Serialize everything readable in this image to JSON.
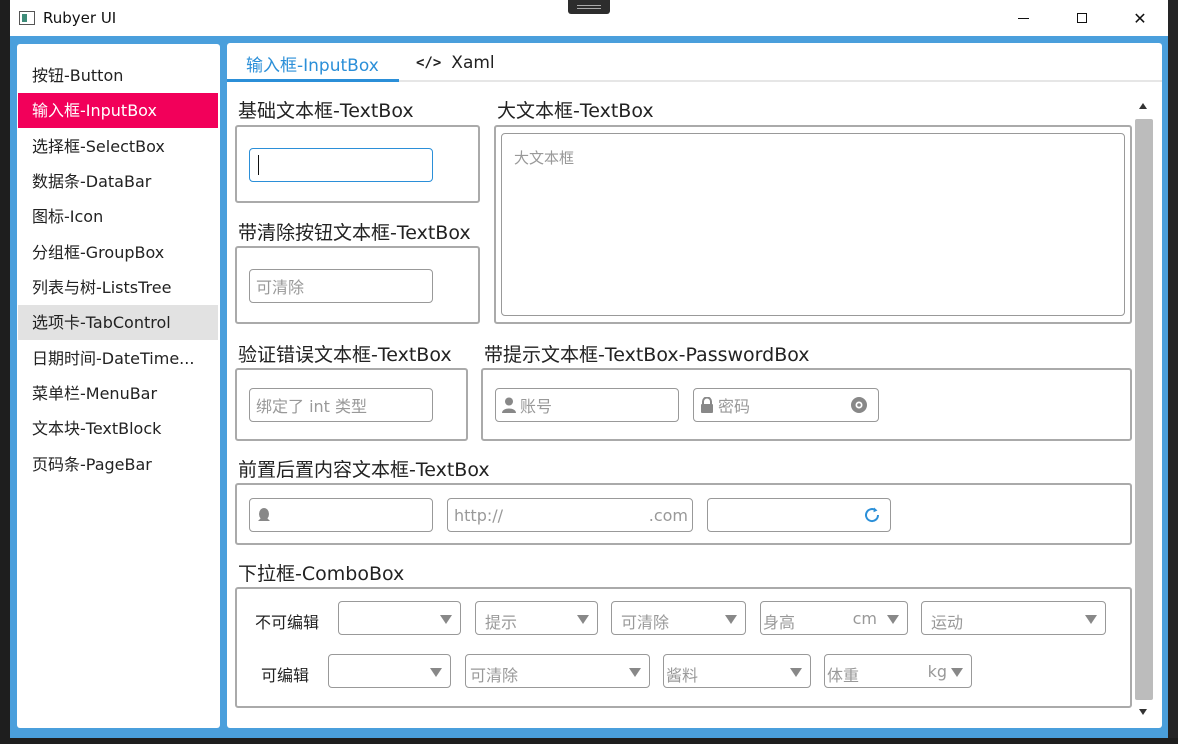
{
  "window": {
    "title": "Rubyer UI"
  },
  "sidebar": {
    "items": [
      {
        "label": "按钮-Button"
      },
      {
        "label": "输入框-InputBox"
      },
      {
        "label": "选择框-SelectBox"
      },
      {
        "label": "数据条-DataBar"
      },
      {
        "label": "图标-Icon"
      },
      {
        "label": "分组框-GroupBox"
      },
      {
        "label": "列表与树-ListsTree"
      },
      {
        "label": "选项卡-TabControl"
      },
      {
        "label": "日期时间-DateTime..."
      },
      {
        "label": "菜单栏-MenuBar"
      },
      {
        "label": "文本块-TextBlock"
      },
      {
        "label": "页码条-PageBar"
      }
    ],
    "active_index": 1,
    "hover_index": 7
  },
  "tabs": [
    {
      "label": "输入框-InputBox"
    },
    {
      "label": "Xaml",
      "icon": "code-icon"
    }
  ],
  "sections": {
    "basic": {
      "title": "基础文本框-TextBox"
    },
    "big": {
      "title": "大文本框-TextBox",
      "placeholder": "大文本框"
    },
    "clear": {
      "title": "带清除按钮文本框-TextBox",
      "placeholder": "可清除"
    },
    "validate": {
      "title": "验证错误文本框-TextBox",
      "placeholder": "绑定了 int 类型"
    },
    "hint": {
      "title": "带提示文本框-TextBox-PasswordBox",
      "account_placeholder": "账号",
      "password_placeholder": "密码"
    },
    "prefix": {
      "title": "前置后置内容文本框-TextBox",
      "url_prefix": "http://",
      "url_suffix": ".com"
    },
    "combo": {
      "title": "下拉框-ComboBox",
      "row1_label": "不可编辑",
      "row1": [
        {
          "text": ""
        },
        {
          "text": "提示"
        },
        {
          "text": "可清除"
        },
        {
          "text": "身高",
          "suffix": "cm"
        },
        {
          "text": "运动"
        }
      ],
      "row2_label": "可编辑",
      "row2": [
        {
          "text": ""
        },
        {
          "text": "可清除"
        },
        {
          "text": "酱料"
        },
        {
          "text": "体重",
          "suffix": "kg"
        }
      ]
    }
  },
  "colors": {
    "accent": "#2b8fd8",
    "active_nav": "#f2005a",
    "window_border": "#4a9fdc"
  }
}
